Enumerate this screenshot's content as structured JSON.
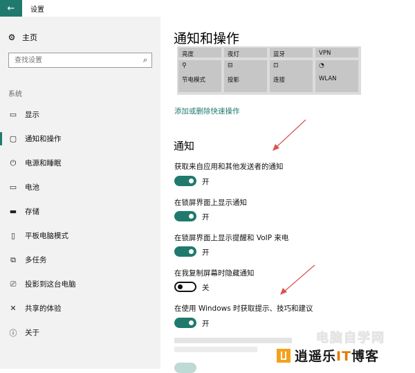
{
  "window": {
    "title": "设置",
    "back_icon": "←"
  },
  "sidebar": {
    "home": {
      "label": "主页",
      "icon": "gear-icon",
      "glyph": "⚙"
    },
    "search": {
      "placeholder": "查找设置",
      "icon": "search-icon",
      "glyph": "⌕"
    },
    "section": "系统",
    "items": [
      {
        "label": "显示",
        "icon": "display-icon",
        "glyph": "▭"
      },
      {
        "label": "通知和操作",
        "icon": "notification-icon",
        "glyph": "▢",
        "selected": true
      },
      {
        "label": "电源和睡眠",
        "icon": "power-icon",
        "glyph": "⏻"
      },
      {
        "label": "电池",
        "icon": "battery-icon",
        "glyph": "▭"
      },
      {
        "label": "存储",
        "icon": "storage-icon",
        "glyph": "▬"
      },
      {
        "label": "平板电脑模式",
        "icon": "tablet-icon",
        "glyph": "▯"
      },
      {
        "label": "多任务",
        "icon": "multitask-icon",
        "glyph": "⧉"
      },
      {
        "label": "投影到这台电脑",
        "icon": "project-icon",
        "glyph": "⎚"
      },
      {
        "label": "共享的体验",
        "icon": "share-icon",
        "glyph": "✕"
      },
      {
        "label": "关于",
        "icon": "info-icon",
        "glyph": "ⓘ"
      }
    ]
  },
  "main": {
    "title": "通知和操作",
    "quick_actions": [
      {
        "label": "亮度",
        "glyph": ""
      },
      {
        "label": "夜灯",
        "glyph": ""
      },
      {
        "label": "蓝牙",
        "glyph": ""
      },
      {
        "label": "VPN",
        "glyph": ""
      },
      {
        "label": "节电模式",
        "glyph": "⚲"
      },
      {
        "label": "投影",
        "glyph": "⊟"
      },
      {
        "label": "连接",
        "glyph": "⊡"
      },
      {
        "label": "WLAN",
        "glyph": "◔"
      }
    ],
    "quick_action_link": "添加或删除快速操作",
    "notifications_heading": "通知",
    "settings": [
      {
        "label": "获取来自应用和其他发送者的通知",
        "state": "开",
        "on": true
      },
      {
        "label": "在锁屏界面上显示通知",
        "state": "开",
        "on": true
      },
      {
        "label": "在锁屏界面上显示提醒和 VoIP 来电",
        "state": "开",
        "on": true
      },
      {
        "label": "在我复制屏幕时隐藏通知",
        "state": "关",
        "on": false
      },
      {
        "label": "在使用 Windows 时获取提示、技巧和建议",
        "state": "开",
        "on": true
      }
    ]
  },
  "colors": {
    "accent": "#1f7a6d",
    "annotation_arrow": "#d9534f"
  },
  "watermark": {
    "top": "电脑自学网",
    "bottom_a": "逍遥乐",
    "bottom_b": "IT",
    "bottom_c": "博客"
  }
}
